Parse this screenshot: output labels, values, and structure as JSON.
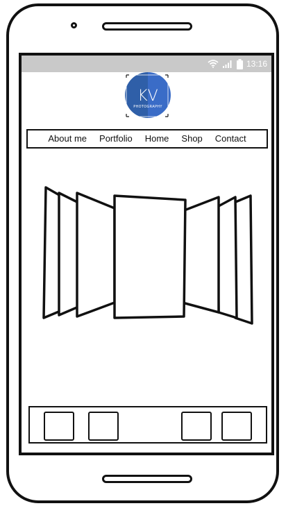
{
  "status_bar": {
    "time": "13:16",
    "icons": [
      "wifi-icon",
      "signal-icon",
      "battery-icon"
    ]
  },
  "logo": {
    "letters": "KV",
    "tagline": "PHOTOGRAPHY",
    "colors": {
      "left": "#2f5fa8",
      "right": "#3a6cc7",
      "text": "#ffffff"
    }
  },
  "nav": {
    "items": [
      {
        "label": "About me"
      },
      {
        "label": "Portfolio"
      },
      {
        "label": "Home"
      },
      {
        "label": "Shop"
      },
      {
        "label": "Contact"
      }
    ]
  },
  "carousel": {
    "slides": [
      "slide",
      "slide",
      "slide",
      "slide",
      "slide",
      "slide",
      "slide"
    ]
  },
  "thumbnails": {
    "count": 4
  },
  "colors": {
    "status_bar": "#c9c9c9",
    "outline": "#111111"
  }
}
